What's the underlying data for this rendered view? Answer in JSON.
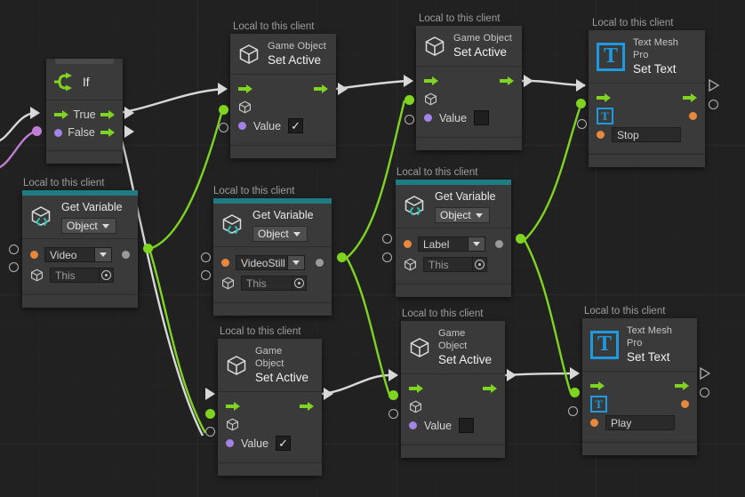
{
  "app": {
    "name": "unity-visual-scripting-graph",
    "canvas_bg": "#212121",
    "accent_teal": "#1d7d82",
    "flow_green": "#7fd421",
    "wire_white": "#d8d8d8",
    "wire_purple": "#c07fd4",
    "tmp_blue": "#1e9ae0"
  },
  "labels": {
    "local_to_client": "Local to this client"
  },
  "nodes": [
    {
      "id": "if",
      "title_sub": "",
      "title_main": "If",
      "icon": "branch-icon",
      "has_client_label": false,
      "rows": [
        {
          "kind": "flow",
          "label": "True",
          "in": true,
          "out": true
        },
        {
          "kind": "value",
          "label": "False",
          "in_dot": "purple",
          "out": true
        }
      ]
    },
    {
      "id": "set-active-1",
      "title_sub": "Game Object",
      "title_main": "Set Active",
      "icon": "cube-icon",
      "has_client_label": true,
      "value_label": "Value",
      "value_checked": true
    },
    {
      "id": "set-active-2",
      "title_sub": "Game Object",
      "title_main": "Set Active",
      "icon": "cube-icon",
      "has_client_label": true,
      "value_label": "Value",
      "value_checked": false
    },
    {
      "id": "set-active-3",
      "title_sub": "Game Object",
      "title_main": "Set Active",
      "icon": "cube-icon",
      "has_client_label": true,
      "value_label": "Value",
      "value_checked": true
    },
    {
      "id": "set-active-4",
      "title_sub": "Game Object",
      "title_main": "Set Active",
      "icon": "cube-icon",
      "has_client_label": true,
      "value_label": "Value",
      "value_checked": false
    },
    {
      "id": "get-variable-1",
      "title_sub": "",
      "title_main": "Get Variable",
      "icon": "variable-cube-icon",
      "kind_dropdown": "Object",
      "has_client_label": true,
      "variable_name": "Video",
      "source_value": "This"
    },
    {
      "id": "get-variable-2",
      "title_sub": "",
      "title_main": "Get Variable",
      "icon": "variable-cube-icon",
      "kind_dropdown": "Object",
      "has_client_label": true,
      "variable_name": "VideoStill",
      "source_value": "This"
    },
    {
      "id": "get-variable-3",
      "title_sub": "",
      "title_main": "Get Variable",
      "icon": "variable-cube-icon",
      "kind_dropdown": "Object",
      "has_client_label": true,
      "variable_name": "Label",
      "source_value": "This"
    },
    {
      "id": "set-text-1",
      "title_sub": "Text Mesh Pro",
      "title_main": "Set Text",
      "icon": "text-mesh-pro-icon",
      "has_client_label": true,
      "text_value": "Stop"
    },
    {
      "id": "set-text-2",
      "title_sub": "Text Mesh Pro",
      "title_main": "Set Text",
      "icon": "text-mesh-pro-icon",
      "has_client_label": true,
      "text_value": "Play"
    }
  ],
  "node_text": {
    "game_object": "Game Object",
    "set_active": "Set Active",
    "get_variable": "Get Variable",
    "text_mesh_pro": "Text Mesh Pro",
    "set_text": "Set Text",
    "if": "If",
    "true": "True",
    "false": "False",
    "value": "Value",
    "object": "Object",
    "this": "This",
    "video": "Video",
    "video_still": "VideoStill",
    "label_var": "Label",
    "stop": "Stop",
    "play": "Play"
  }
}
